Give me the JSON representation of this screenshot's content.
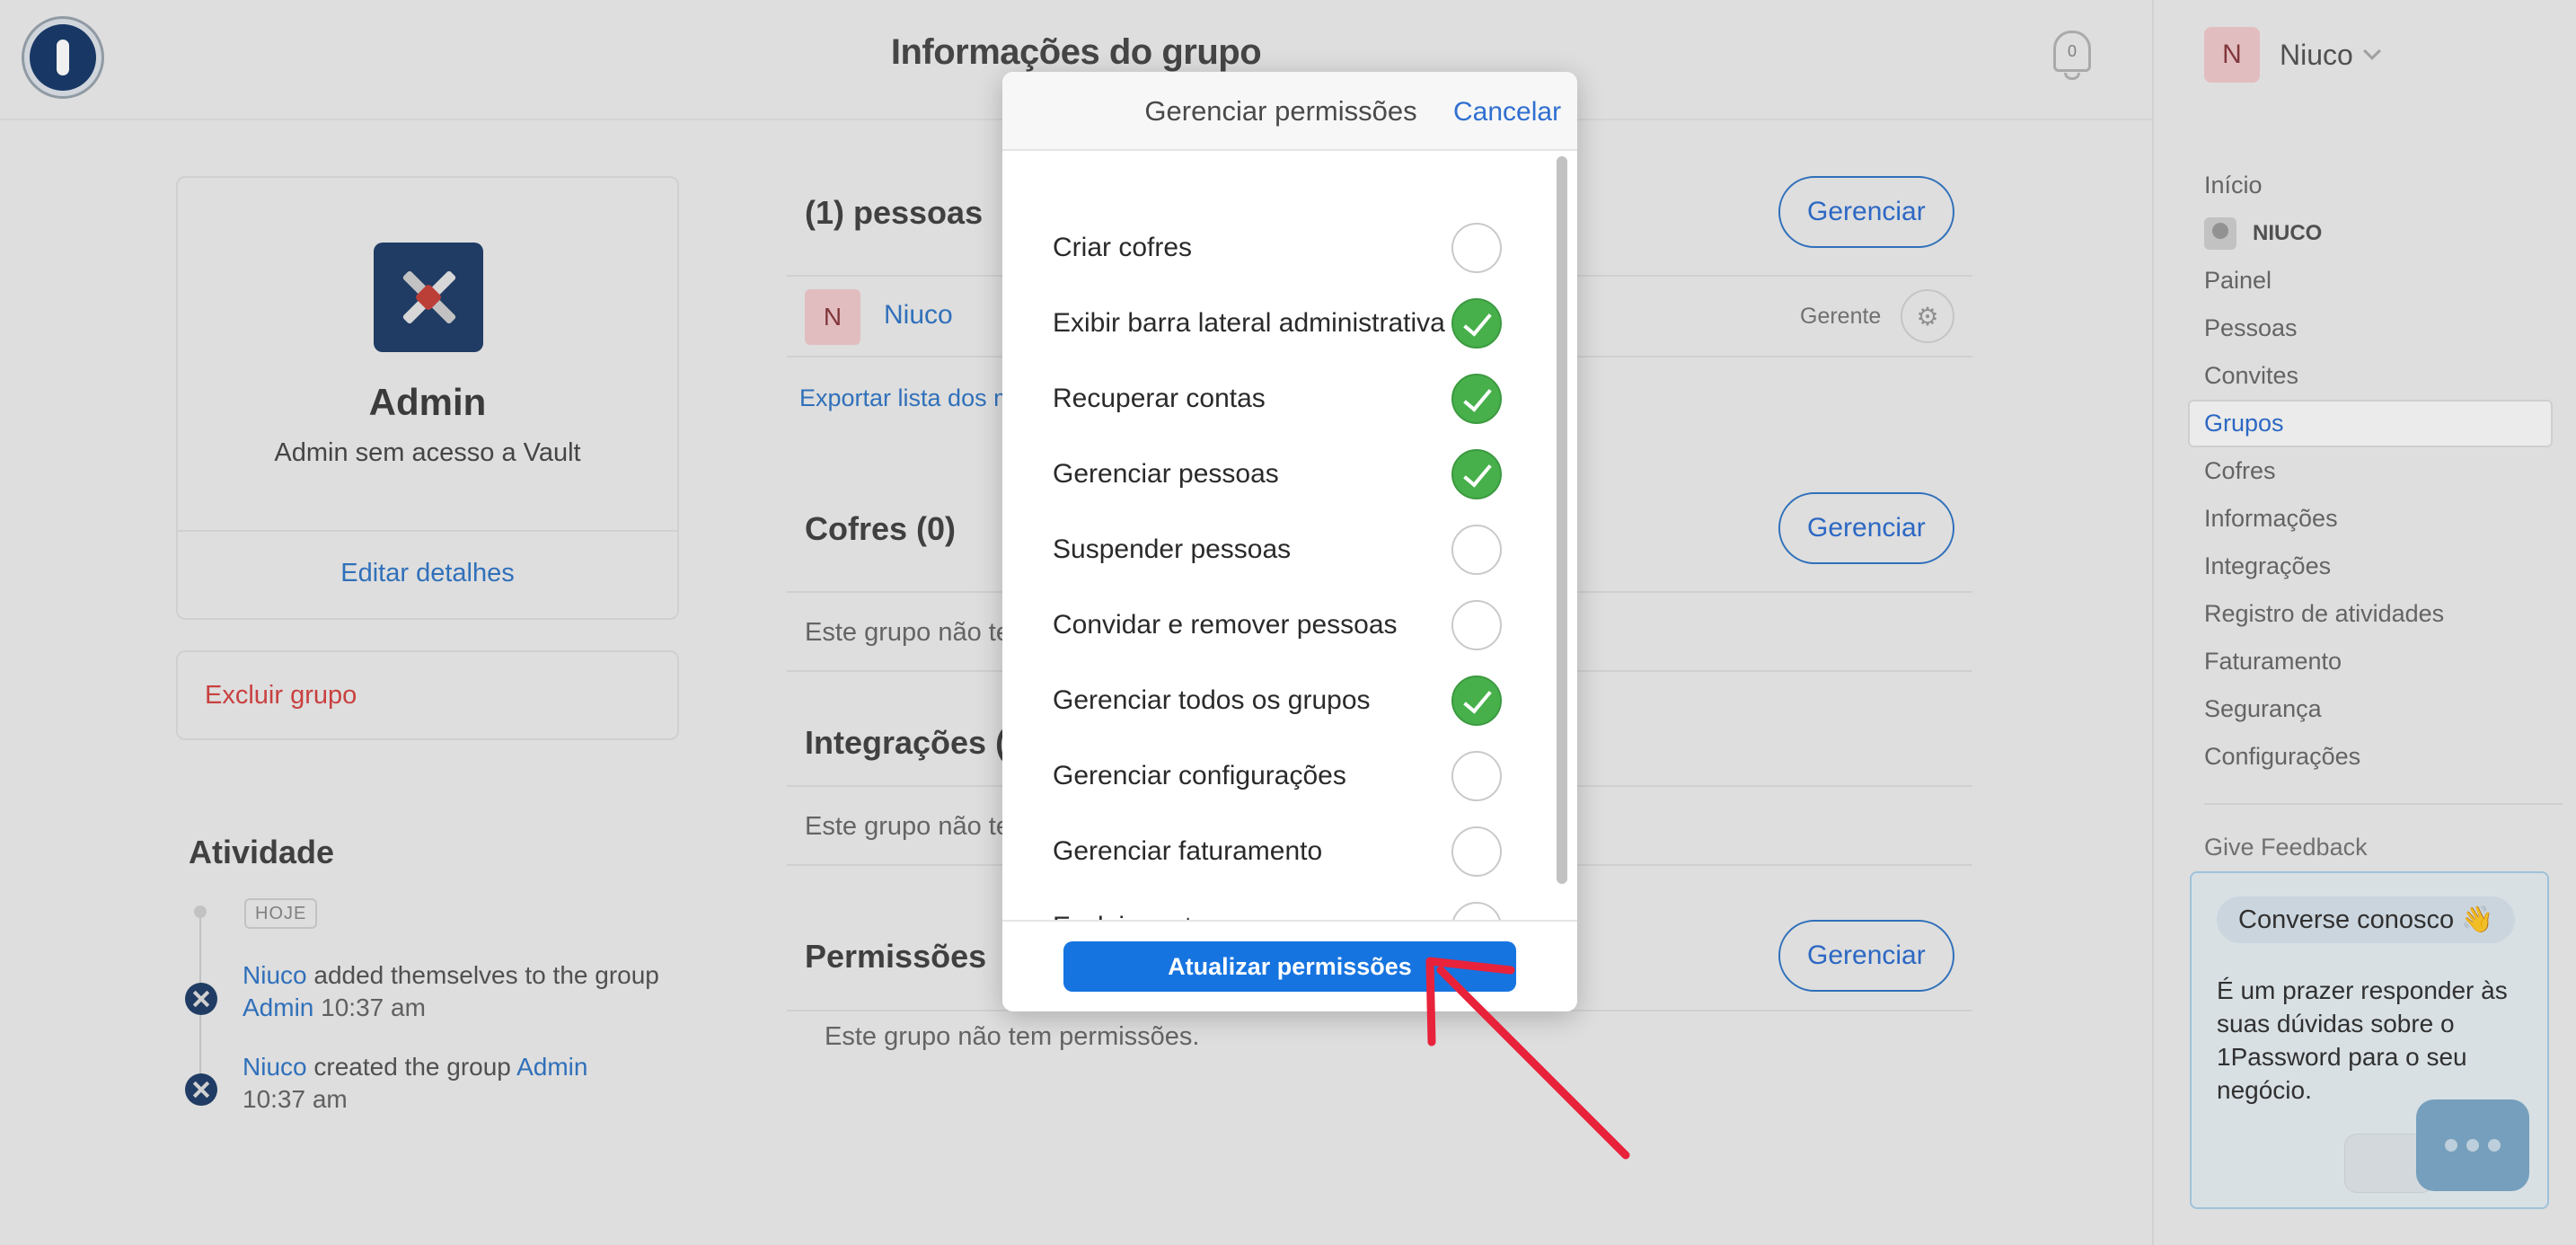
{
  "header": {
    "title": "Informações do grupo",
    "notifications_count": "0"
  },
  "user": {
    "initial": "N",
    "name": "Niuco"
  },
  "sidebar": {
    "items": [
      {
        "label": "Início"
      },
      {
        "label": "NIUCO"
      },
      {
        "label": "Painel"
      },
      {
        "label": "Pessoas"
      },
      {
        "label": "Convites"
      },
      {
        "label": "Grupos"
      },
      {
        "label": "Cofres"
      },
      {
        "label": "Informações"
      },
      {
        "label": "Integrações"
      },
      {
        "label": "Registro de atividades"
      },
      {
        "label": "Faturamento"
      },
      {
        "label": "Segurança"
      },
      {
        "label": "Configurações"
      }
    ],
    "active_item": "Grupos",
    "feedback": "Give Feedback",
    "chat": {
      "pill": "Converse conosco 👋",
      "text": "É um prazer responder às suas dúvidas sobre o 1Password para o seu negócio."
    }
  },
  "group": {
    "name": "Admin",
    "description": "Admin sem acesso a Vault",
    "edit_link": "Editar detalhes",
    "delete": "Excluir grupo"
  },
  "activity": {
    "title": "Atividade",
    "today_badge": "HOJE",
    "entries": [
      {
        "actor": "Niuco",
        "text": " added themselves to the group ",
        "target": "Admin",
        "time": "10:37 am"
      },
      {
        "actor": "Niuco",
        "text": " created the group ",
        "target": "Admin",
        "time": "10:37 am"
      }
    ]
  },
  "sections": {
    "people": {
      "title": "(1) pessoas",
      "button": "Gerenciar",
      "member": {
        "initial": "N",
        "name": "Niuco",
        "role": "Gerente"
      },
      "export": "Exportar lista dos m"
    },
    "vaults": {
      "title": "Cofres (0)",
      "button": "Gerenciar",
      "empty": "Este grupo não te"
    },
    "integrations": {
      "title": "Integrações (",
      "empty": "Este grupo não te"
    },
    "permissions": {
      "title": "Permissões",
      "button": "Gerenciar",
      "empty": "Este grupo não tem permissões."
    }
  },
  "modal": {
    "title": "Gerenciar permissões",
    "cancel": "Cancelar",
    "submit": "Atualizar permissões",
    "permissions": [
      {
        "label": "Criar cofres",
        "checked": false
      },
      {
        "label": "Exibir barra lateral administrativa",
        "checked": true
      },
      {
        "label": "Recuperar contas",
        "checked": true
      },
      {
        "label": "Gerenciar pessoas",
        "checked": true
      },
      {
        "label": "Suspender pessoas",
        "checked": false
      },
      {
        "label": "Convidar e remover pessoas",
        "checked": false
      },
      {
        "label": "Gerenciar todos os grupos",
        "checked": true
      },
      {
        "label": "Gerenciar configurações",
        "checked": false
      },
      {
        "label": "Gerenciar faturamento",
        "checked": false
      },
      {
        "label": "Excluir conta",
        "checked": false
      }
    ]
  },
  "colors": {
    "accent": "#1674e0",
    "link": "#3478c6",
    "check_on": "#47b04b",
    "danger": "#d64545",
    "annotation_arrow": "#e8223a"
  }
}
